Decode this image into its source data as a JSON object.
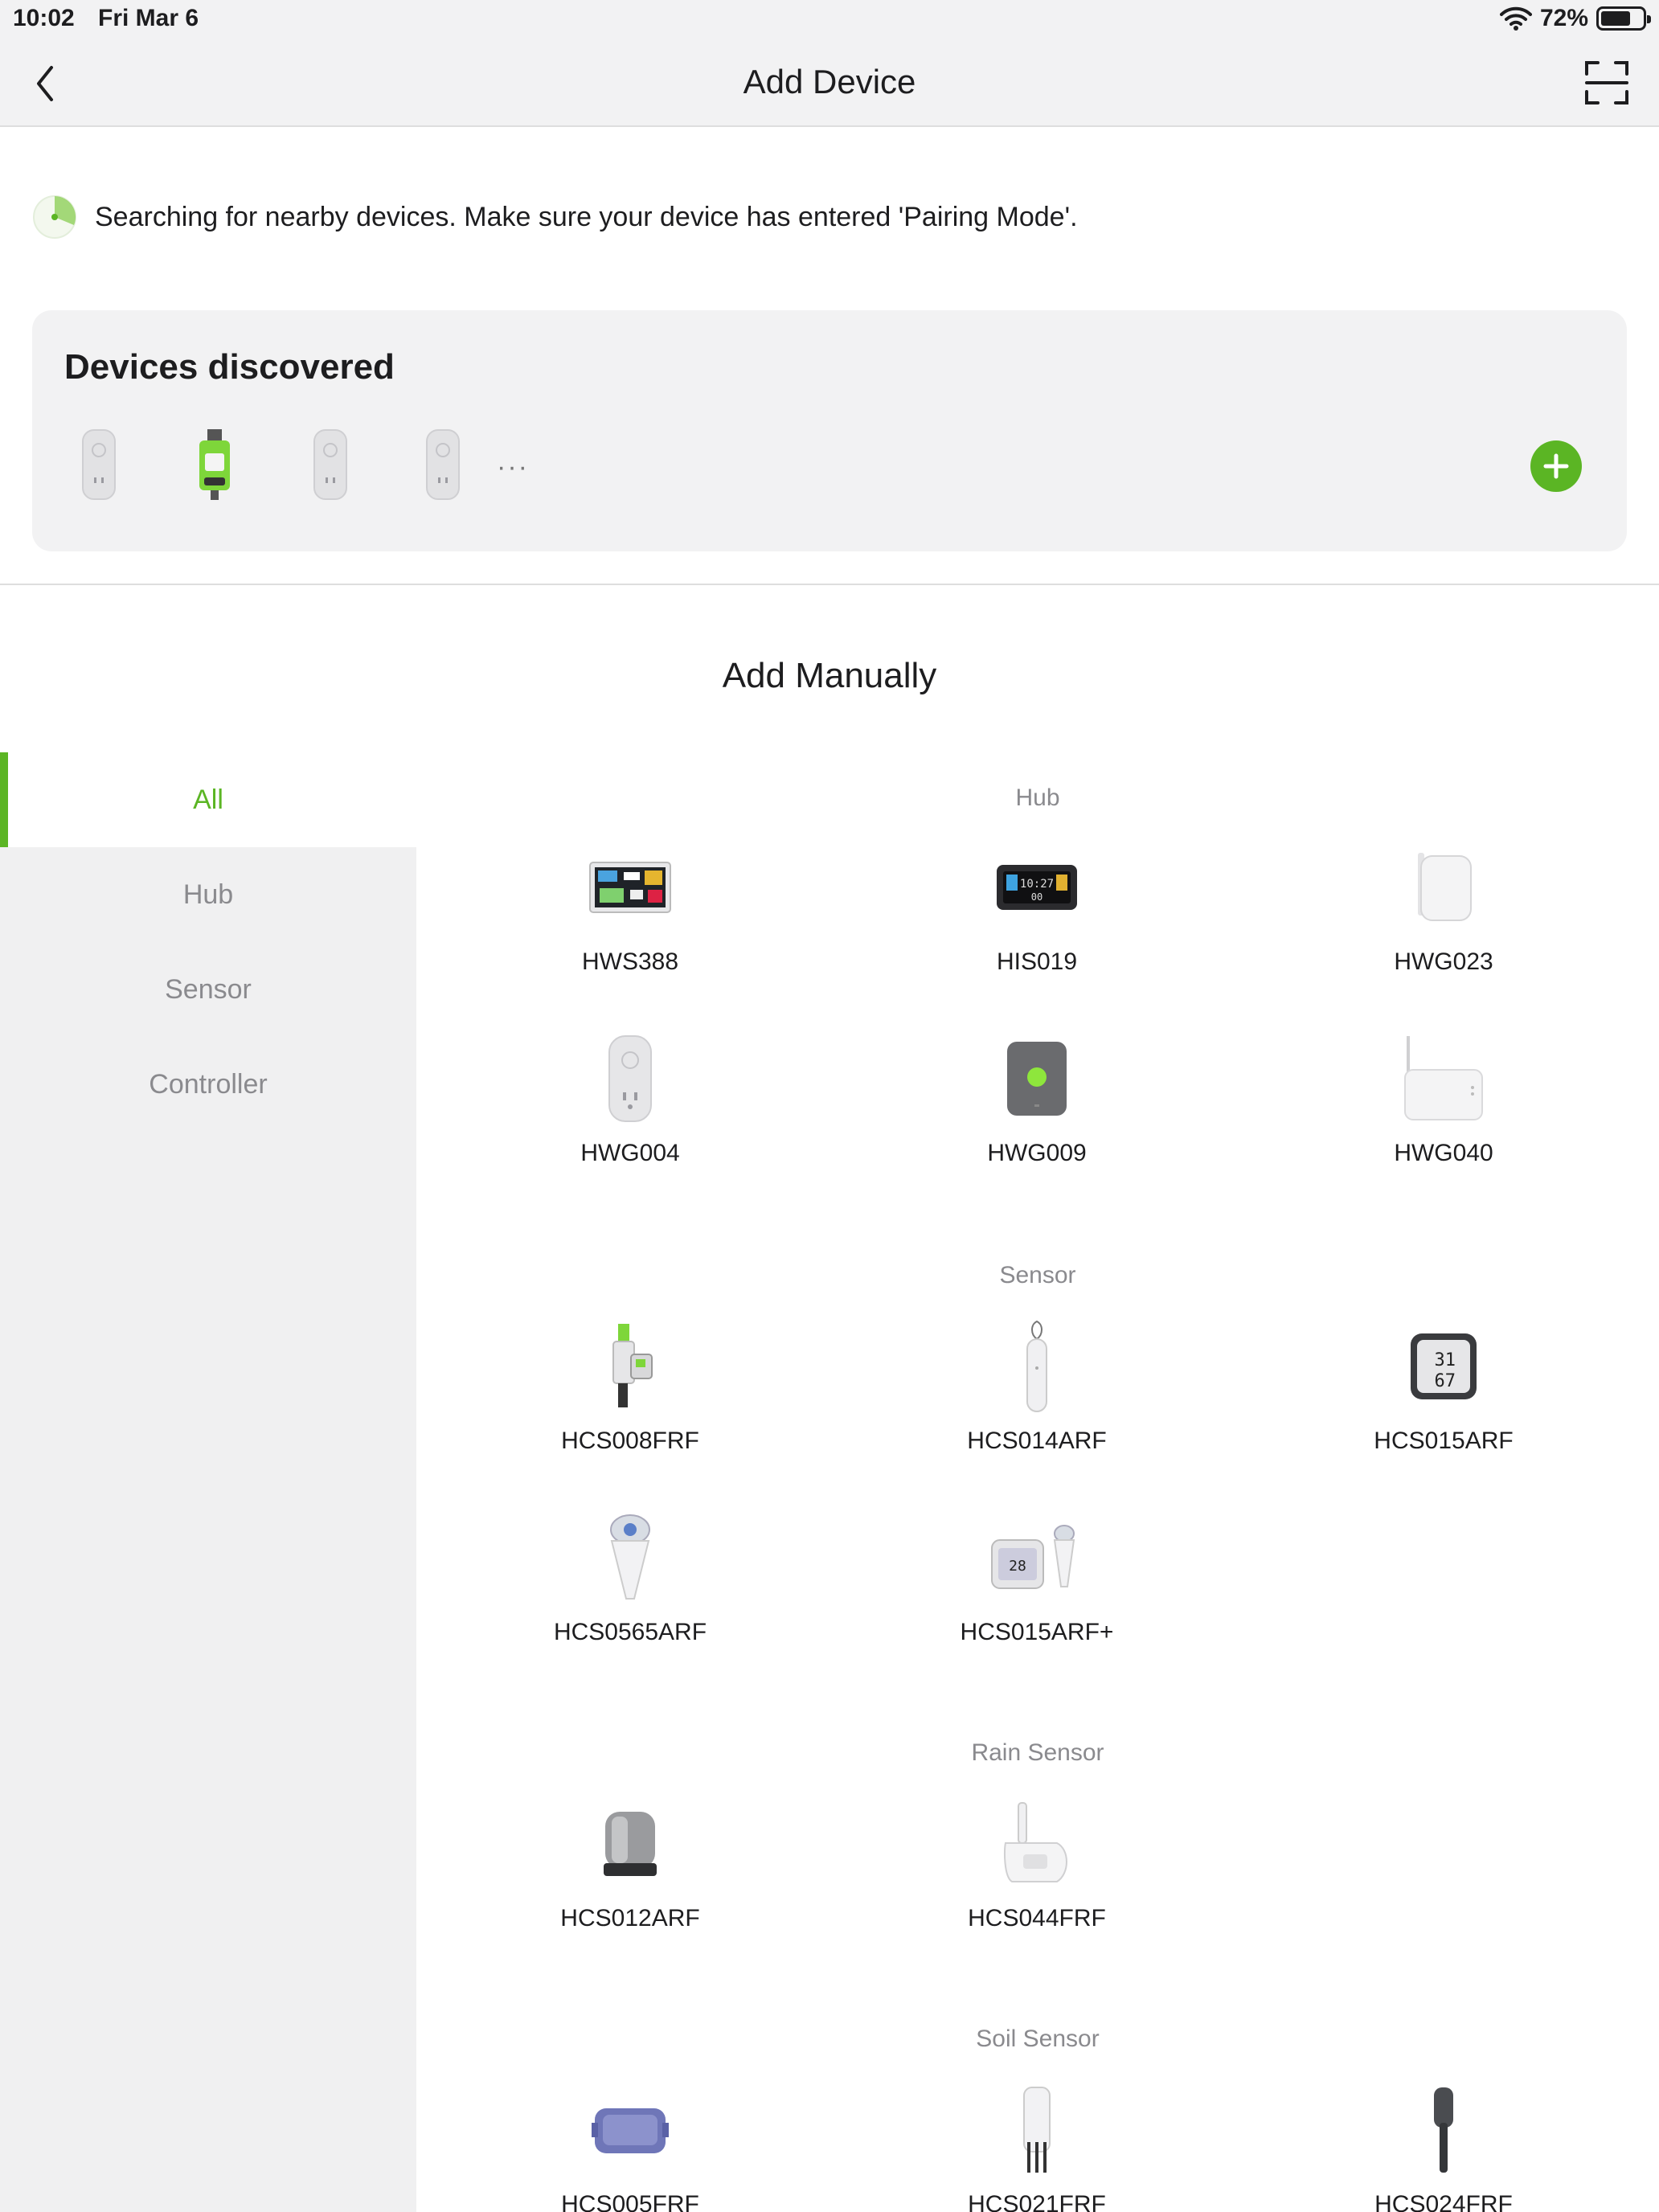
{
  "status": {
    "time": "10:02",
    "date": "Fri Mar 6",
    "battery": "72%",
    "battery_level": 0.72
  },
  "nav": {
    "title": "Add Device"
  },
  "searching": {
    "text": "Searching for nearby devices. Make sure your device has entered 'Pairing Mode'."
  },
  "discovered": {
    "title": "Devices discovered",
    "more": "···"
  },
  "manual": {
    "title": "Add Manually"
  },
  "sidebar": {
    "items": [
      "All",
      "Hub",
      "Sensor",
      "Controller"
    ],
    "active": "All"
  },
  "sections": {
    "hub": {
      "label": "Hub",
      "devices": [
        "HWS388",
        "HIS019",
        "HWG023",
        "HWG004",
        "HWG009",
        "HWG040"
      ]
    },
    "sensor": {
      "label": "Sensor",
      "devices": [
        "HCS008FRF",
        "HCS014ARF",
        "HCS015ARF",
        "HCS0565ARF",
        "HCS015ARF+"
      ]
    },
    "rain": {
      "label": "Rain Sensor",
      "devices": [
        "HCS012ARF",
        "HCS044FRF"
      ]
    },
    "soil": {
      "label": "Soil Sensor",
      "devices": [
        "HCS005FRF",
        "HCS021FRF",
        "HCS024FRF"
      ]
    }
  },
  "colors": {
    "accent": "#5bb524",
    "sidebar_bg": "#f0f0f1",
    "panel_bg": "#f2f2f3"
  }
}
